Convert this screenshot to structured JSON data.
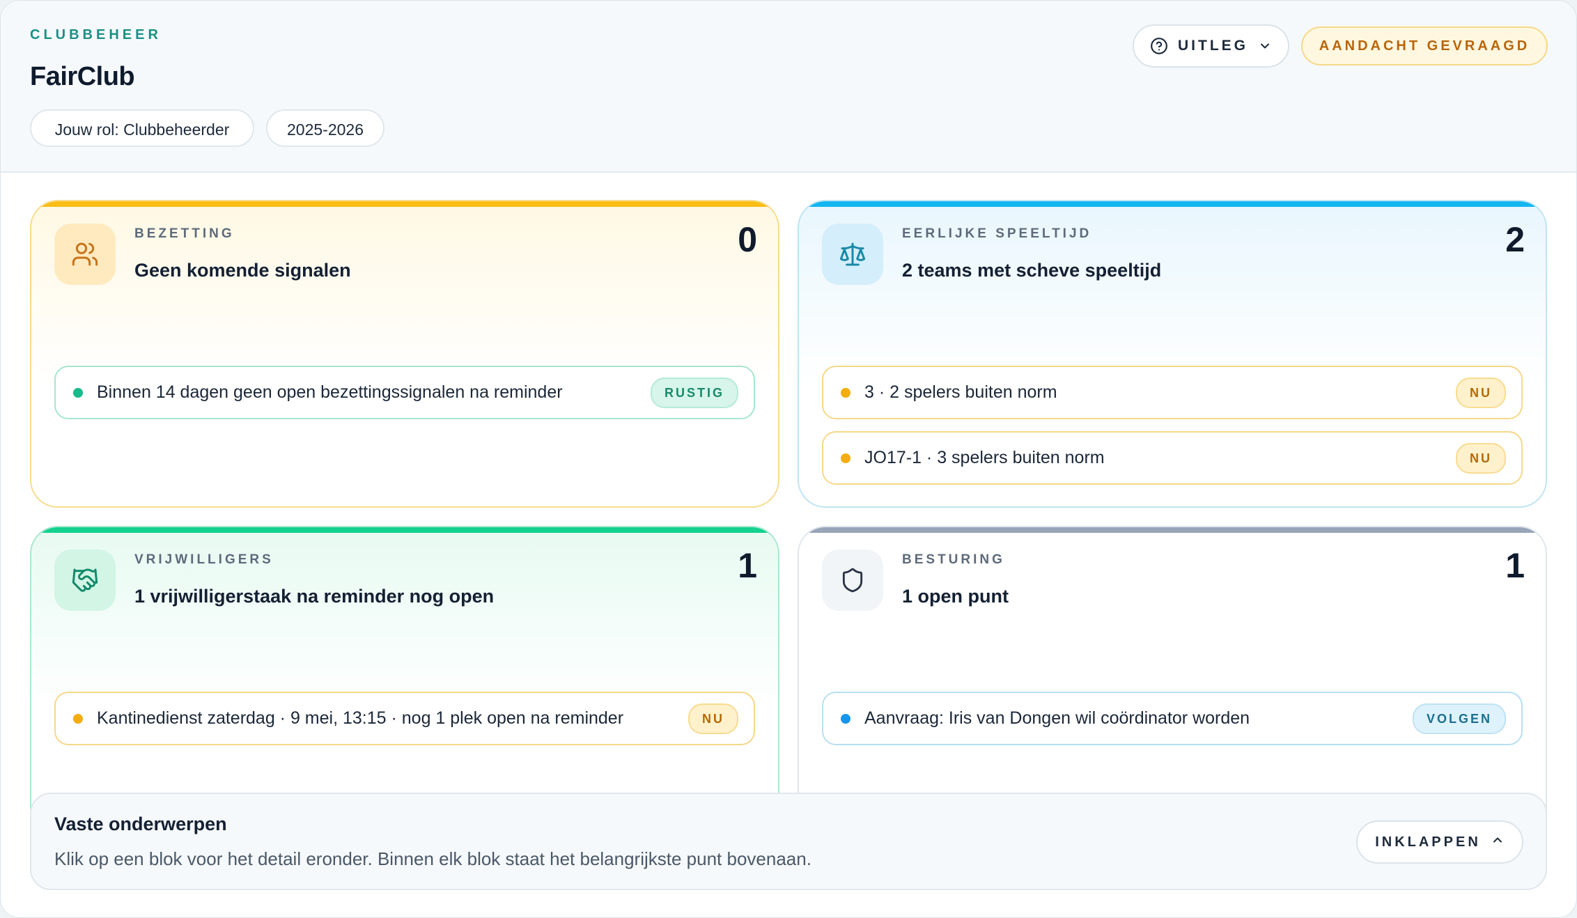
{
  "header": {
    "eyebrow": "CLUBBEHEER",
    "title": "FairClub",
    "role_pill": "Jouw rol: Clubbeheerder",
    "season_pill": "2025-2026",
    "help_button": "UITLEG",
    "attention_badge": "AANDACHT GEVRAAGD"
  },
  "cards": [
    {
      "category": "BEZETTING",
      "title": "Geen komende signalen",
      "count": "0",
      "icon": "users-icon",
      "accent": "#f9bd16",
      "items": [
        {
          "text": "Binnen 14 dagen geen open bezettingssignalen na reminder",
          "tag": "RUSTIG",
          "status": "green"
        }
      ]
    },
    {
      "category": "EERLIJKE SPEELTIJD",
      "title": "2 teams met scheve speeltijd",
      "count": "2",
      "icon": "scale-icon",
      "accent": "#12b6f0",
      "items": [
        {
          "text": "3 · 2 spelers buiten norm",
          "tag": "NU",
          "status": "amber"
        },
        {
          "text": "JO17-1 · 3 spelers buiten norm",
          "tag": "NU",
          "status": "amber"
        }
      ]
    },
    {
      "category": "VRIJWILLIGERS",
      "title": "1 vrijwilligerstaak na reminder nog open",
      "count": "1",
      "icon": "handshake-icon",
      "accent": "#13d18f",
      "items": [
        {
          "text": "Kantinedienst zaterdag · 9 mei, 13:15 · nog 1 plek open na reminder",
          "tag": "NU",
          "status": "amber"
        }
      ]
    },
    {
      "category": "BESTURING",
      "title": "1 open punt",
      "count": "1",
      "icon": "shield-icon",
      "accent": "#98a4b8",
      "items": [
        {
          "text": "Aanvraag: Iris van Dongen wil coördinator worden",
          "tag": "VOLGEN",
          "status": "blue"
        }
      ]
    }
  ],
  "footer": {
    "title": "Vaste onderwerpen",
    "description": "Klik op een blok voor het detail eronder. Binnen elk blok staat het belangrijkste punt bovenaan.",
    "collapse_button": "INKLAPPEN"
  }
}
